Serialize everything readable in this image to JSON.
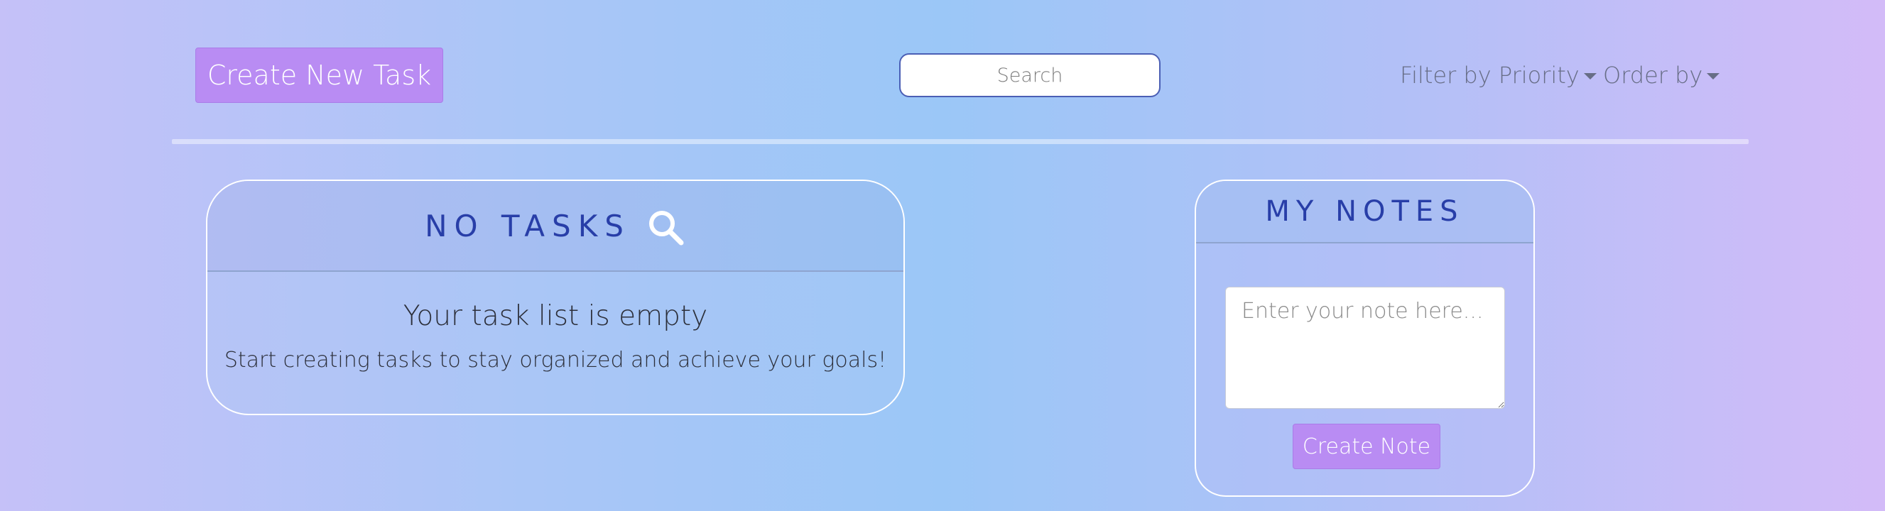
{
  "header": {
    "create_task_label": "Create New Task",
    "search_placeholder": "Search",
    "filter_priority_label": "Filter by Priority",
    "order_by_label": "Order by"
  },
  "tasks": {
    "title": "NO TASKS",
    "icon": "search-icon",
    "empty_title": "Your task list is empty",
    "empty_subtitle": "Start creating tasks to stay organized and achieve your goals!"
  },
  "notes": {
    "title": "MY NOTES",
    "textarea_placeholder": "Enter your note here...",
    "create_note_label": "Create Note"
  },
  "colors": {
    "accent_button": "#b98cf3",
    "heading_blue": "#283ea8",
    "card_border": "#ffffff"
  }
}
